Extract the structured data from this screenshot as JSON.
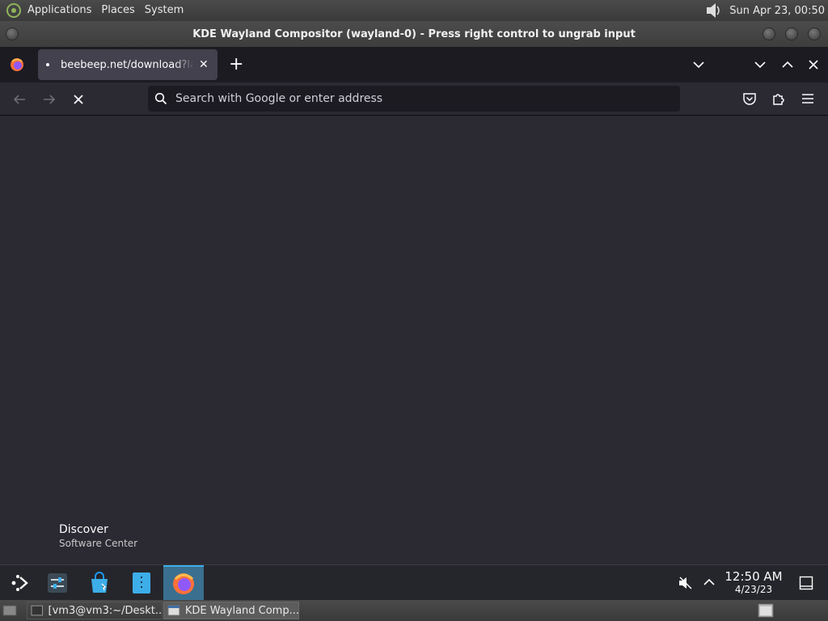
{
  "gnome_panel": {
    "menus": [
      "Applications",
      "Places",
      "System"
    ],
    "clock": "Sun Apr 23, 00:50"
  },
  "compositor": {
    "title": "KDE Wayland Compositor (wayland-0) - Press right control to ungrab input"
  },
  "browser": {
    "tab_title": "beebeep.net/download?lang=en",
    "new_tab_label": "+",
    "url_placeholder": "Search with Google or enter address",
    "url_value": ""
  },
  "tooltip": {
    "title": "Discover",
    "subtitle": "Software Center"
  },
  "kde_taskbar": {
    "clock_time": "12:50 AM",
    "clock_date": "4/23/23"
  },
  "gnome_taskbar": {
    "tasks": [
      "[vm3@vm3:~/Deskt...",
      "KDE Wayland Comp..."
    ]
  },
  "colors": {
    "accent": "#3daee9",
    "firefox_bg": "#2b2a33",
    "tab_bg": "#42414d"
  }
}
